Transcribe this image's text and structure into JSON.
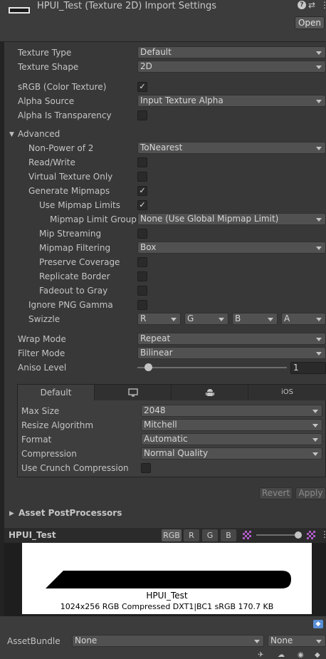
{
  "header": {
    "title": "HPUI_Test (Texture 2D) Import Settings",
    "help_icon": "help-icon",
    "settings_icon": "settings-icon",
    "menu_icon": "kebab-menu-icon",
    "open_label": "Open"
  },
  "fields": {
    "texture_type": {
      "label": "Texture Type",
      "value": "Default"
    },
    "texture_shape": {
      "label": "Texture Shape",
      "value": "2D"
    },
    "srgb": {
      "label": "sRGB (Color Texture)",
      "checked": true
    },
    "alpha_source": {
      "label": "Alpha Source",
      "value": "Input Texture Alpha"
    },
    "alpha_is_transparency": {
      "label": "Alpha Is Transparency",
      "checked": false
    },
    "advanced": {
      "label": "Advanced",
      "expanded": true
    },
    "non_power_of_2": {
      "label": "Non-Power of 2",
      "value": "ToNearest"
    },
    "read_write": {
      "label": "Read/Write",
      "checked": false
    },
    "virtual_texture_only": {
      "label": "Virtual Texture Only",
      "checked": false
    },
    "generate_mipmaps": {
      "label": "Generate Mipmaps",
      "checked": true
    },
    "use_mipmap_limits": {
      "label": "Use Mipmap Limits",
      "checked": true
    },
    "mipmap_limit_group": {
      "label": "Mipmap Limit Group",
      "value": "None (Use Global Mipmap Limit)"
    },
    "mip_streaming": {
      "label": "Mip Streaming",
      "checked": false
    },
    "mipmap_filtering": {
      "label": "Mipmap Filtering",
      "value": "Box"
    },
    "preserve_coverage": {
      "label": "Preserve Coverage",
      "checked": false
    },
    "replicate_border": {
      "label": "Replicate Border",
      "checked": false
    },
    "fadeout_to_gray": {
      "label": "Fadeout to Gray",
      "checked": false
    },
    "ignore_png_gamma": {
      "label": "Ignore PNG Gamma",
      "checked": false
    },
    "swizzle": {
      "label": "Swizzle",
      "values": [
        "R",
        "G",
        "B",
        "A"
      ]
    },
    "wrap_mode": {
      "label": "Wrap Mode",
      "value": "Repeat"
    },
    "filter_mode": {
      "label": "Filter Mode",
      "value": "Bilinear"
    },
    "aniso_level": {
      "label": "Aniso Level",
      "value": "1",
      "level": 1
    }
  },
  "platform": {
    "tabs": [
      "Default",
      "monitor-icon",
      "android-icon",
      "iOS"
    ],
    "active_tab": "Default",
    "max_size": {
      "label": "Max Size",
      "value": "2048"
    },
    "resize_algorithm": {
      "label": "Resize Algorithm",
      "value": "Mitchell"
    },
    "format": {
      "label": "Format",
      "value": "Automatic"
    },
    "compression": {
      "label": "Compression",
      "value": "Normal Quality"
    },
    "use_crunch": {
      "label": "Use Crunch Compression",
      "checked": false
    }
  },
  "actions": {
    "revert_label": "Revert",
    "apply_label": "Apply"
  },
  "postprocessors": {
    "label": "Asset PostProcessors"
  },
  "preview": {
    "title": "HPUI_Test",
    "buttons": [
      "RGB",
      "R",
      "G",
      "B"
    ],
    "active_button": "RGB",
    "name": "HPUI_Test",
    "info": "1024x256  RGB Compressed DXT1|BC1 sRGB   170.7 KB"
  },
  "footer": {
    "assetbundle_label": "AssetBundle",
    "assetbundle_value": "None",
    "variant_value": "None"
  },
  "colors": {
    "background": "#383838",
    "field": "#515151",
    "checkbox": "#2a2a2a",
    "text": "#c4c4c4"
  }
}
